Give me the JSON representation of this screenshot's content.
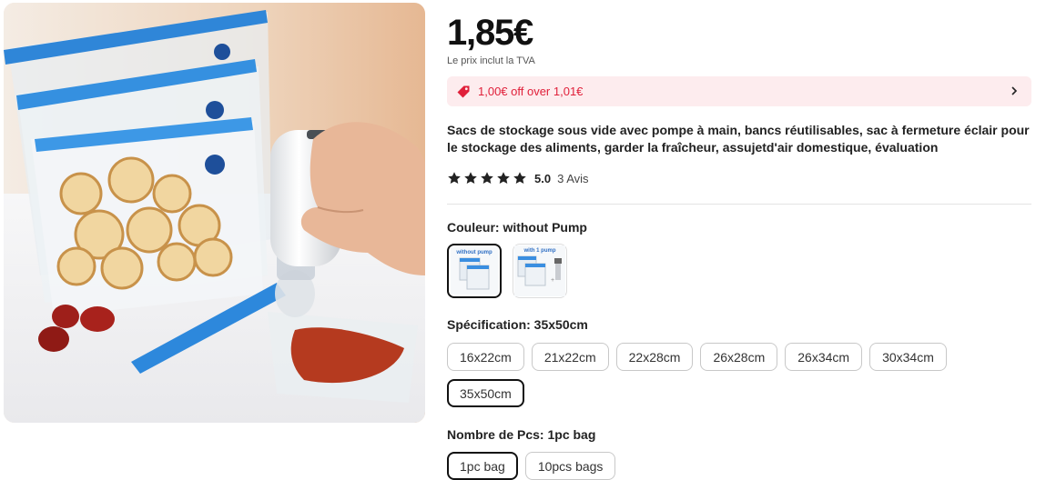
{
  "product": {
    "price": "1,85€",
    "vat_note": "Le prix inclut la TVA",
    "promo_text": "1,00€ off over 1,01€",
    "title": "Sacs de stockage sous vide avec pompe à main, bancs réutilisables, sac à fermeture éclair pour le stockage des aliments, garder la fraîcheur, assujetd'air domestique, évaluation",
    "rating": {
      "stars": 5,
      "value": "5.0",
      "count_text": "3 Avis"
    }
  },
  "colors": {
    "accent": "#e0203a",
    "promo_bg": "#fdecee",
    "selected_border": "#111111"
  },
  "icons": {
    "promo": "price-tag-icon",
    "chevron": "chevron-right-icon",
    "star": "star-icon"
  },
  "color_option": {
    "label": "Couleur: without Pump",
    "swatches": [
      {
        "caption": "without pump",
        "selected": true
      },
      {
        "caption": "with 1 pump",
        "selected": false
      }
    ]
  },
  "spec_option": {
    "label": "Spécification: 35x50cm",
    "options": [
      "16x22cm",
      "21x22cm",
      "22x28cm",
      "26x28cm",
      "26x34cm",
      "30x34cm",
      "35x50cm"
    ],
    "selected": "35x50cm"
  },
  "pcs_option": {
    "label": "Nombre de Pcs: 1pc bag",
    "options": [
      "1pc bag",
      "10pcs bags"
    ],
    "selected": "1pc bag"
  }
}
